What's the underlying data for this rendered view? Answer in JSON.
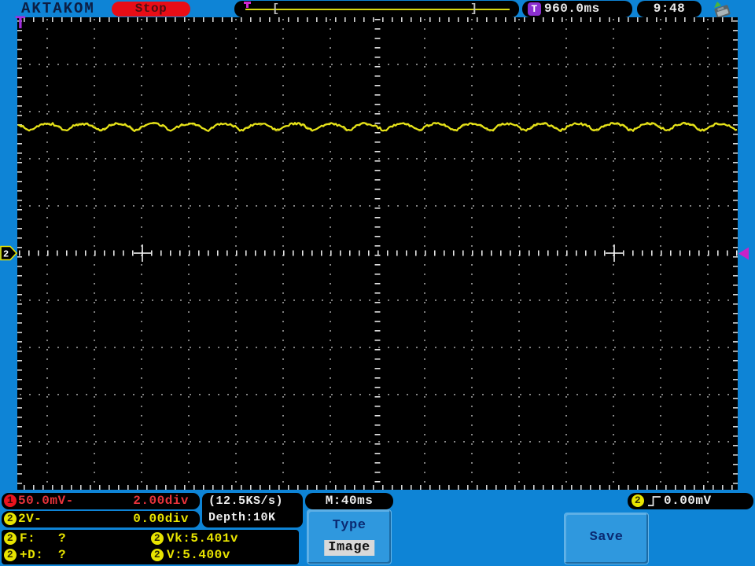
{
  "header": {
    "brand": "AKTAKOM",
    "run_status": "Stop",
    "record_bar": {
      "left_bracket": "[",
      "right_bracket": "]"
    },
    "trigger_position": {
      "symbol": "T",
      "time": "960.0ms"
    },
    "clock": "9:48"
  },
  "channels": [
    {
      "id": "1",
      "scale": "50.0mV-",
      "position": "2.00div",
      "color": "#e8333a"
    },
    {
      "id": "2",
      "scale": "2V-",
      "position": "0.00div",
      "color": "#e8e400"
    }
  ],
  "acquisition": {
    "sample_rate": "(12.5KS/s)",
    "depth": "Depth:10K",
    "timebase": "M:40ms"
  },
  "trigger": {
    "channel": "2",
    "edge": "rising",
    "level": "0.00mV"
  },
  "measurements": [
    {
      "ch": "2",
      "label": "F:",
      "value": "?"
    },
    {
      "ch": "2",
      "label": "Vk:",
      "value": "5.401v"
    },
    {
      "ch": "2",
      "label": "+D:",
      "value": "?"
    },
    {
      "ch": "2",
      "label": "V:",
      "value": "5.400v"
    }
  ],
  "menu": {
    "type_label": "Type",
    "type_value": "Image",
    "save_label": "Save"
  },
  "markers": {
    "ch2_position_label": "2",
    "trigger_position_marker": "T"
  },
  "colors": {
    "background_blue": "#0e84d6",
    "button_blue": "#2f98de",
    "trace_yellow": "#e8e41a",
    "ch1_red": "#e8333a",
    "ch2_yellow": "#e8e400",
    "trigger_purple": "#c822c8",
    "stop_red": "#e80d16"
  },
  "chart_data": {
    "type": "line",
    "title": "",
    "series": [
      {
        "name": "CH2",
        "color": "#e8e41a",
        "mean_volts": 5.4,
        "ripple_pp_volts": 0.35,
        "ripple_period_ms": 30
      }
    ],
    "x_axis": {
      "label": "time",
      "time_per_div_ms": 40,
      "visible_divisions": 15.3
    },
    "y_axis": {
      "label": "volts",
      "volts_per_div_ch2": 2,
      "divisions": 10
    },
    "notes": "CH2 DC level ~5.4V (2.7 divisions above center) with small sawtooth ripple plus noise; CH1 not visible"
  }
}
